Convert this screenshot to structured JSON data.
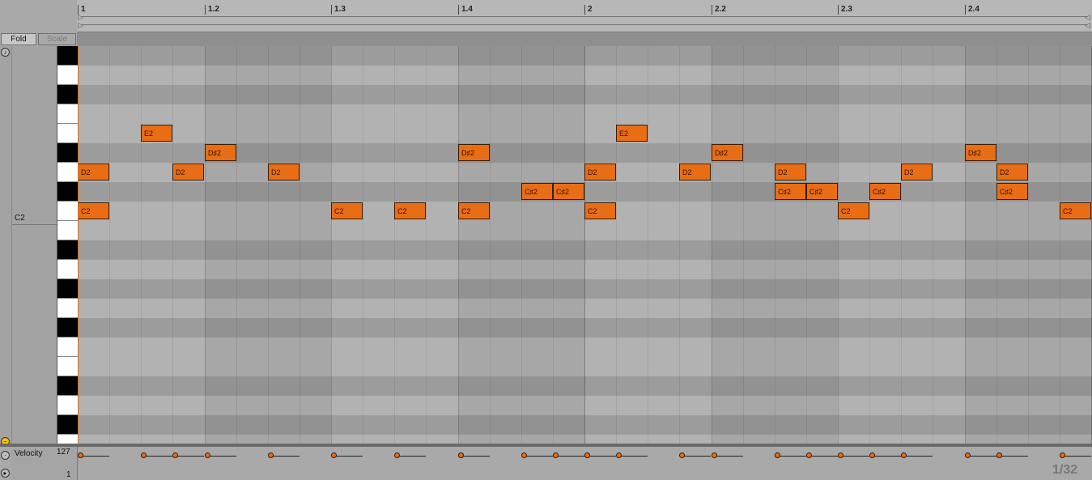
{
  "toolbar": {
    "fold_label": "Fold",
    "scale_label": "Scale"
  },
  "ruler": {
    "ticks": [
      "1",
      "1.2",
      "1.3",
      "1.4",
      "2",
      "2.2",
      "2.3",
      "2.4"
    ]
  },
  "piano": {
    "c2_label": "C2"
  },
  "notes": [
    {
      "pitch": "D2",
      "start": 0,
      "len": 0.25
    },
    {
      "pitch": "C2",
      "start": 0,
      "len": 0.25
    },
    {
      "pitch": "E2",
      "start": 0.5,
      "len": 0.25
    },
    {
      "pitch": "D2",
      "start": 0.75,
      "len": 0.25
    },
    {
      "pitch": "D♯2",
      "start": 1.0,
      "len": 0.25
    },
    {
      "pitch": "D2",
      "start": 1.5,
      "len": 0.25
    },
    {
      "pitch": "C2",
      "start": 2.0,
      "len": 0.25
    },
    {
      "pitch": "C2",
      "start": 2.5,
      "len": 0.25
    },
    {
      "pitch": "D♯2",
      "start": 3.0,
      "len": 0.25
    },
    {
      "pitch": "C2",
      "start": 3.0,
      "len": 0.25
    },
    {
      "pitch": "C♯2",
      "start": 3.5,
      "len": 0.25
    },
    {
      "pitch": "C♯2",
      "start": 3.75,
      "len": 0.25
    },
    {
      "pitch": "D2",
      "start": 4.0,
      "len": 0.25
    },
    {
      "pitch": "C2",
      "start": 4.0,
      "len": 0.25
    },
    {
      "pitch": "E2",
      "start": 4.25,
      "len": 0.25
    },
    {
      "pitch": "D2",
      "start": 4.75,
      "len": 0.25
    },
    {
      "pitch": "D♯2",
      "start": 5.0,
      "len": 0.25
    },
    {
      "pitch": "D2",
      "start": 5.5,
      "len": 0.25
    },
    {
      "pitch": "C♯2",
      "start": 5.5,
      "len": 0.25
    },
    {
      "pitch": "C♯2",
      "start": 5.75,
      "len": 0.25
    },
    {
      "pitch": "C2",
      "start": 6.0,
      "len": 0.25
    },
    {
      "pitch": "C♯2",
      "start": 6.25,
      "len": 0.25
    },
    {
      "pitch": "D2",
      "start": 6.5,
      "len": 0.25
    },
    {
      "pitch": "D♯2",
      "start": 7.0,
      "len": 0.25
    },
    {
      "pitch": "D2",
      "start": 7.25,
      "len": 0.25
    },
    {
      "pitch": "C♯2",
      "start": 7.25,
      "len": 0.25
    },
    {
      "pitch": "C2",
      "start": 7.75,
      "len": 0.25
    }
  ],
  "velocity": {
    "label": "Velocity",
    "max_label": "127",
    "min_label": "1"
  },
  "grid_label": "1/32",
  "colors": {
    "note": "#e96d15",
    "playhead": "#e06a1a"
  }
}
